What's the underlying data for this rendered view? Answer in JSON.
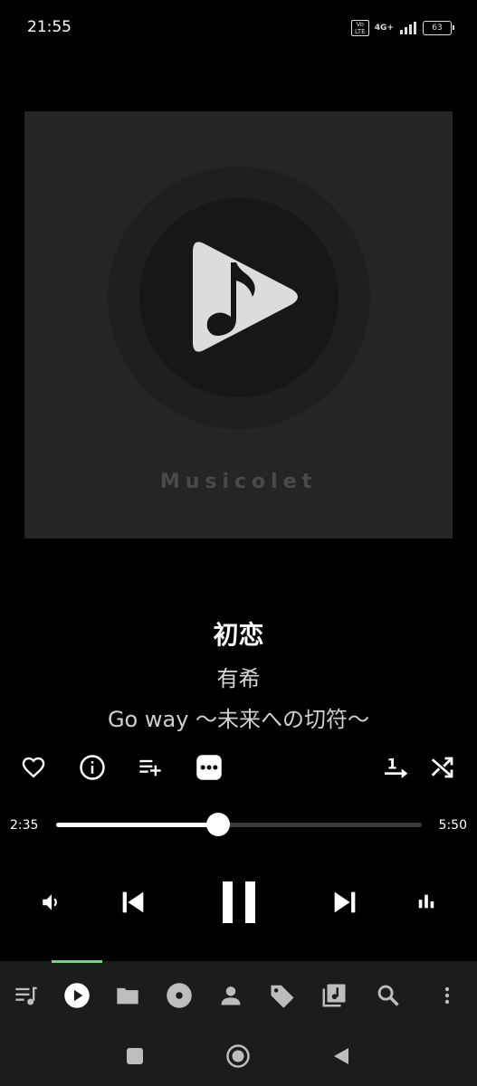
{
  "status": {
    "time": "21:55",
    "volte": "Vo LTE",
    "network": "4G+",
    "battery": "63"
  },
  "album_art": {
    "brand_text": "Musicolet",
    "icon": "musicolet-logo-icon"
  },
  "track": {
    "title": "初恋",
    "artist": "有希",
    "album": "Go way ～未来への切符～"
  },
  "actions": [
    {
      "icon": "heart-icon"
    },
    {
      "icon": "info-icon"
    },
    {
      "icon": "add-to-queue-icon"
    },
    {
      "icon": "more-options-icon"
    },
    {
      "icon": "repeat-one-icon"
    },
    {
      "icon": "shuffle-icon"
    }
  ],
  "seek": {
    "elapsed": "2:35",
    "duration": "5:50",
    "progress": 0.443
  },
  "controls": {
    "volume": "volume-icon",
    "previous": "skip-previous-icon",
    "play_pause": "pause-icon",
    "next": "skip-next-icon",
    "equalizer": "equalizer-icon"
  },
  "tabs": [
    {
      "icon": "queue-icon",
      "active": false
    },
    {
      "icon": "play-icon",
      "active": true
    },
    {
      "icon": "folder-icon",
      "active": false
    },
    {
      "icon": "album-icon",
      "active": false
    },
    {
      "icon": "artist-icon",
      "active": false
    },
    {
      "icon": "tag-icon",
      "active": false
    },
    {
      "icon": "playlist-icon",
      "active": false
    },
    {
      "icon": "search-icon",
      "active": false
    },
    {
      "icon": "overflow-menu-icon",
      "active": false
    }
  ],
  "colors": {
    "accent": "#5de36f",
    "background": "#000000",
    "bar": "#1c1c1c"
  }
}
